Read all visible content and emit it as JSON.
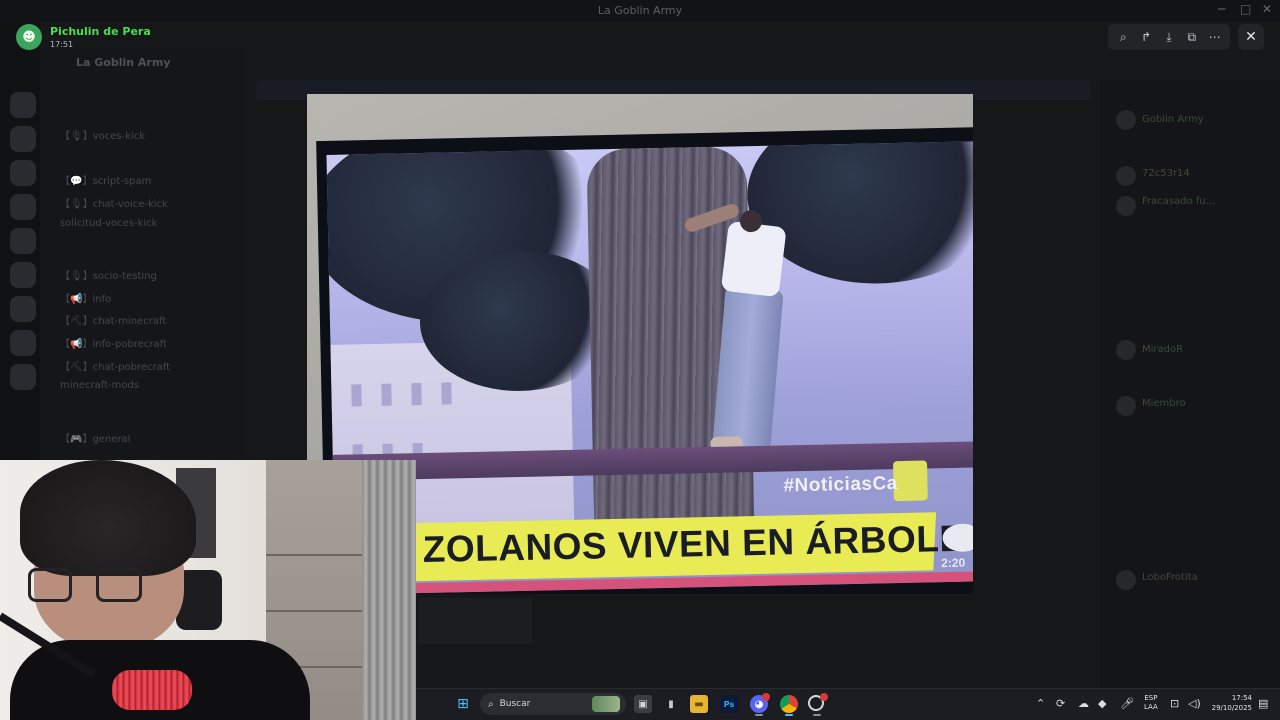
{
  "window": {
    "title": "La Goblin Army"
  },
  "background": {
    "server_name": "La Goblin Army",
    "channels": [
      "【🎙】voces-kick",
      "【💬】script-spam",
      "【🎙】chat-voice-kick",
      "solicitud-voces-kick",
      "【🎙】socio-testing",
      "【📢】info",
      "【⛏】chat-minecraft",
      "【📢】info-pobrecraft",
      "【⛏】chat-pobrecraft",
      "minecraft-mods",
      "【🎮】general"
    ],
    "members": [
      "Goblin Army",
      "72c53r14",
      "Fracasado fu...",
      "MiradoR",
      "Miembro",
      "LoboFrotita"
    ]
  },
  "viewer": {
    "user_name": "Pichulin de Pera",
    "time": "17:51",
    "tools": [
      {
        "name": "zoom-icon",
        "glyph": "⌕"
      },
      {
        "name": "forward-icon",
        "glyph": "↱"
      },
      {
        "name": "download-icon",
        "glyph": "⤓"
      },
      {
        "name": "open-external-icon",
        "glyph": "⧉"
      },
      {
        "name": "more-icon",
        "glyph": "⋯"
      }
    ],
    "close_glyph": "✕"
  },
  "media": {
    "hashtag": "#NoticiasCa",
    "headline": "ZOLANOS VIVEN EN ÁRBOLES",
    "clock": "2:20"
  },
  "taskbar": {
    "search_label": "Buscar",
    "lang_line1": "ESP",
    "lang_line2": "LAA",
    "time": "17:54",
    "date": "29/10/2025"
  },
  "colors": {
    "accent_green": "#4ade50",
    "lower_third": "#e9eb54",
    "discord_blurple": "#5865f2"
  }
}
